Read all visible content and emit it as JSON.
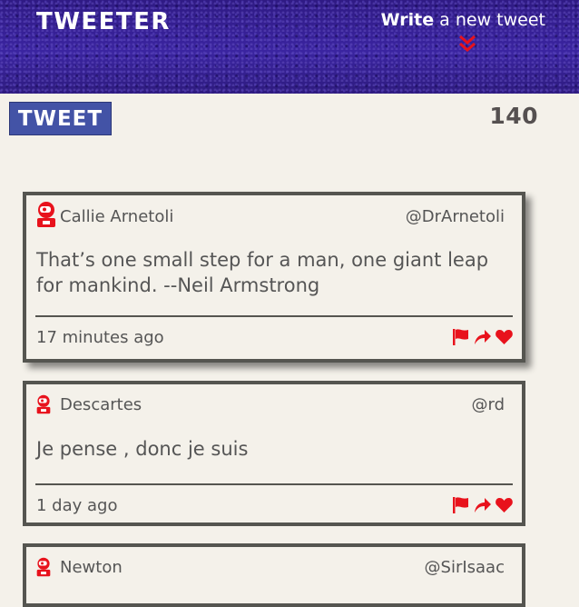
{
  "header": {
    "logo": "TWEETER",
    "compose_bold": "Write",
    "compose_rest": " a new tweet"
  },
  "composer": {
    "tweet_button": "TWEET",
    "char_count": "140"
  },
  "tweets": [
    {
      "name": "Callie Arnetoli",
      "handle": "@DrArnetoli",
      "content": "That’s one small step for a man, one giant leap for mankind. --Neil Armstrong",
      "time": "17 minutes ago"
    },
    {
      "name": "Descartes",
      "handle": "@rd",
      "content": "Je pense , donc je suis",
      "time": "1 day ago"
    },
    {
      "name": "Newton",
      "handle": "@SirIsaac"
    }
  ],
  "icons": {
    "flag": "flag-icon",
    "retweet": "share-icon",
    "like": "heart-icon",
    "avatar": "robot-avatar-icon",
    "compose": "chevron-double-down-icon"
  },
  "colors": {
    "header_bg": "#34208a",
    "button_bg": "#4353a6",
    "accent_red": "#e8121c",
    "page_bg": "#f4f1ea",
    "card_border": "#555550"
  }
}
